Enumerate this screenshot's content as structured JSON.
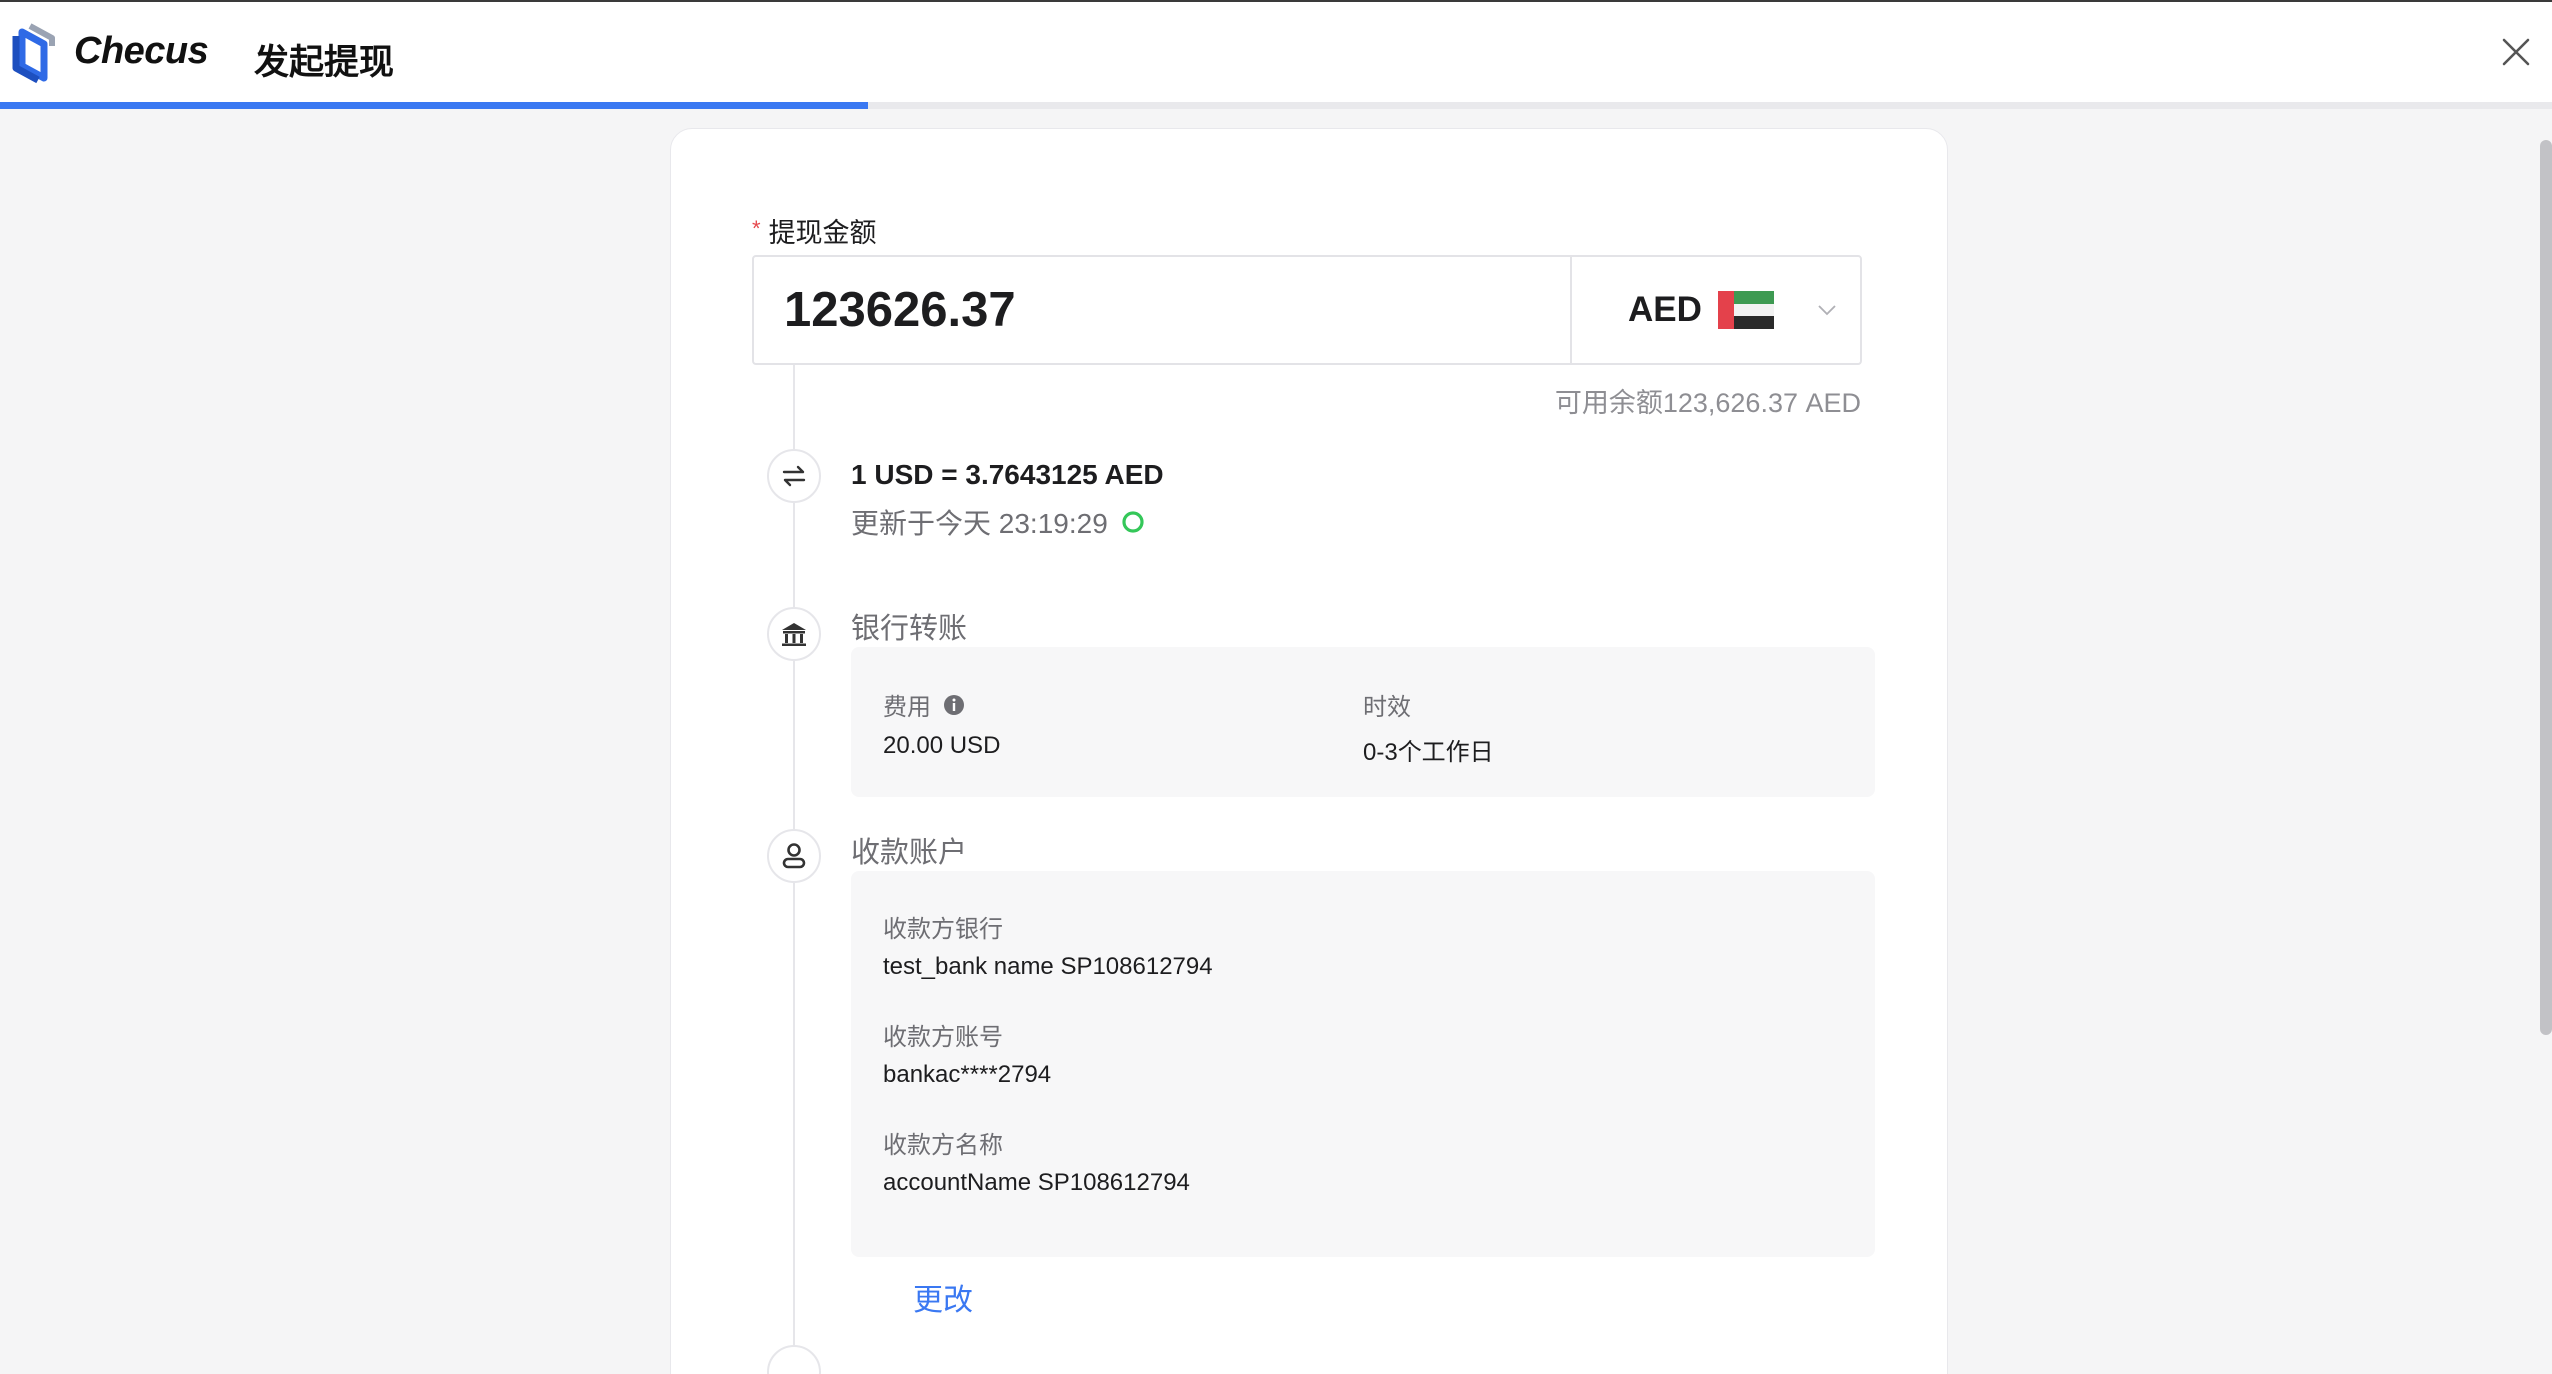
{
  "app": {
    "brand": "Checus",
    "title": "发起提现",
    "progress_percent": 34
  },
  "form": {
    "amount_label_required": "*",
    "amount_label": "提现金额",
    "amount_value": "123626.37",
    "currency_code": "AED",
    "balance_text": "可用余额123,626.37 AED"
  },
  "rate": {
    "main": "1 USD = 3.7643125 AED",
    "updated": "更新于今天 23:19:29"
  },
  "bank_transfer": {
    "title": "银行转账",
    "fee_label": "费用",
    "fee_value": "20.00 USD",
    "time_label": "时效",
    "time_value": "0-3个工作日"
  },
  "payee": {
    "title": "收款账户",
    "bank_label": "收款方银行",
    "bank_value": "test_bank name SP108612794",
    "account_label": "收款方账号",
    "account_value": "bankac****2794",
    "name_label": "收款方名称",
    "name_value": "accountName SP108612794",
    "change_link": "更改"
  },
  "colors": {
    "accent": "#3a78f2",
    "required": "#e5484d",
    "refresh_green": "#34c759",
    "flag_red": "#e4414b",
    "flag_green": "#3e9a52",
    "flag_black": "#2a2a2a"
  },
  "icons": {
    "exchange": "exchange-icon",
    "bank": "bank-icon",
    "user": "user-icon",
    "close": "close-icon",
    "chevron": "chevron-down-icon",
    "info": "info-icon",
    "refresh": "refresh-icon"
  }
}
